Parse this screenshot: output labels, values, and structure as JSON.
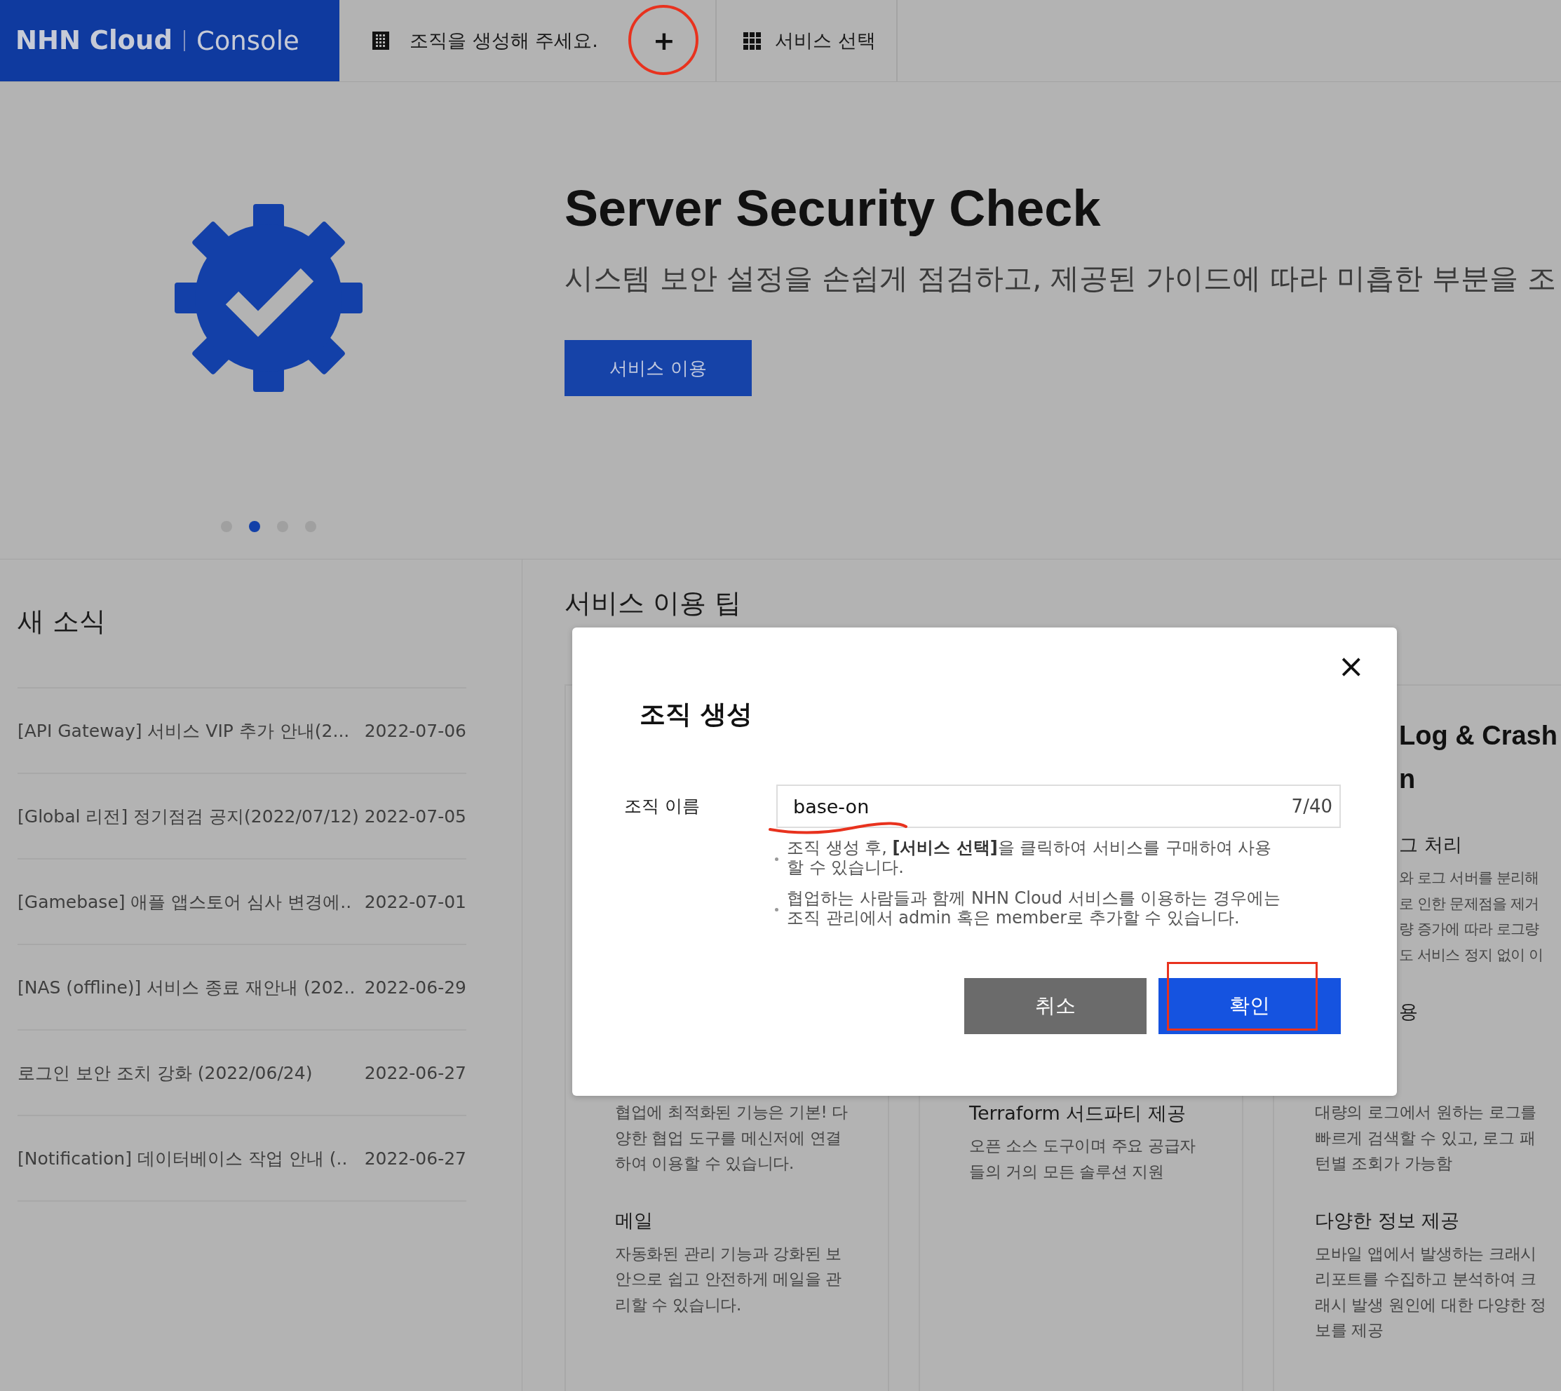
{
  "top_bar": {
    "logo": {
      "brand": "NHN Cloud",
      "product": "Console"
    },
    "org_tab": {
      "label": "조직을 생성해 주세요."
    },
    "add_button": {
      "label": "+",
      "circled": true
    },
    "service_tab": {
      "label": "서비스 선택"
    }
  },
  "hero": {
    "title": "Server Security Check",
    "subtitle": "시스템 보안 설정을 손쉽게 점검하고, 제공된 가이드에 따라 미흡한 부분을 조",
    "button": "서비스 이용",
    "dots": [
      {
        "selected": false
      },
      {
        "selected": true
      },
      {
        "selected": false
      },
      {
        "selected": false
      }
    ]
  },
  "news": {
    "title": "새 소식",
    "items": [
      {
        "title": "[API Gateway] 서비스 VIP 추가 안내(2...",
        "date": "2022-07-06"
      },
      {
        "title": "[Global 리전] 정기점검 공지(2022/07/12)",
        "date": "2022-07-05"
      },
      {
        "title": "[Gamebase] 애플 앱스토어 심사 변경에..",
        "date": "2022-07-01"
      },
      {
        "title": "[NAS (offline)] 서비스 종료 재안내 (202..",
        "date": "2022-06-29"
      },
      {
        "title": "로그인 보안 조치 강화 (2022/06/24)",
        "date": "2022-06-27"
      },
      {
        "title": "[Notification] 데이터베이스 작업 안내 (..",
        "date": "2022-06-27"
      }
    ]
  },
  "tips": {
    "title": "서비스 이용 팁",
    "cards": [
      {
        "lower_lines": [
          {
            "kind": "line",
            "text": "협업에 최적화된 기능은 기본! 다"
          },
          {
            "kind": "line",
            "text": "양한 협업 도구를 메신저에 연결"
          },
          {
            "kind": "line",
            "text": "하여 이용할 수 있습니다."
          },
          {
            "kind": "heading",
            "text": "메일"
          },
          {
            "kind": "line",
            "text": "자동화된 관리 기능과 강화된 보"
          },
          {
            "kind": "line",
            "text": "안으로 쉽고 안전하게 메일을 관"
          },
          {
            "kind": "line",
            "text": "리할 수 있습니다."
          }
        ]
      },
      {
        "lower_lines": [
          {
            "kind": "subtitle",
            "text": "Terraform 서드파티 제공"
          },
          {
            "kind": "line",
            "text": "오픈 소스 도구이며 주요 공급자"
          },
          {
            "kind": "line",
            "text": "들의 거의 모든 솔루션 지원"
          }
        ]
      },
      {
        "upper_lines": [
          {
            "kind": "title",
            "text": "Log & Crash"
          },
          {
            "kind": "title",
            "text": "n"
          },
          {
            "kind": "heading",
            "text": "그 처리"
          },
          {
            "kind": "line",
            "text": "와 로그 서버를 분리해"
          },
          {
            "kind": "line",
            "text": "로 인한 문제점을 제거"
          },
          {
            "kind": "line",
            "text": "량 증가에 따라 로그량"
          },
          {
            "kind": "line",
            "text": "도 서비스 정지 없이 이"
          },
          {
            "kind": "heading",
            "text": "용"
          }
        ],
        "lower_lines": [
          {
            "kind": "line",
            "text": "대량의 로그에서 원하는 로그를"
          },
          {
            "kind": "line",
            "text": "빠르게 검색할 수 있고, 로그 패"
          },
          {
            "kind": "line",
            "text": "턴별 조회가 가능함"
          },
          {
            "kind": "heading",
            "text": "다양한 정보 제공"
          },
          {
            "kind": "line",
            "text": "모바일 앱에서 발생하는 크래시"
          },
          {
            "kind": "line",
            "text": "리포트를 수집하고 분석하여 크"
          },
          {
            "kind": "line",
            "text": "래시 발생 원인에 대한 다양한 정"
          },
          {
            "kind": "line",
            "text": "보를 제공"
          }
        ]
      }
    ]
  },
  "modal": {
    "title": "조직 생성",
    "close": "×",
    "field_label": "조직 이름",
    "field_value": "base-on",
    "underlined": true,
    "counter": "7/40",
    "help": [
      "조직 생성 후, **[서비스 선택]**을 클릭하여 서비스를 구매하여 사용할 수 있습니다.",
      "협업하는 사람들과 함께 NHN Cloud 서비스를 이용하는 경우에는 조직 관리에서 admin 혹은 member로 추가할 수 있습니다."
    ],
    "cancel": "취소",
    "confirm": {
      "label": "확인",
      "highlighted": true
    }
  }
}
